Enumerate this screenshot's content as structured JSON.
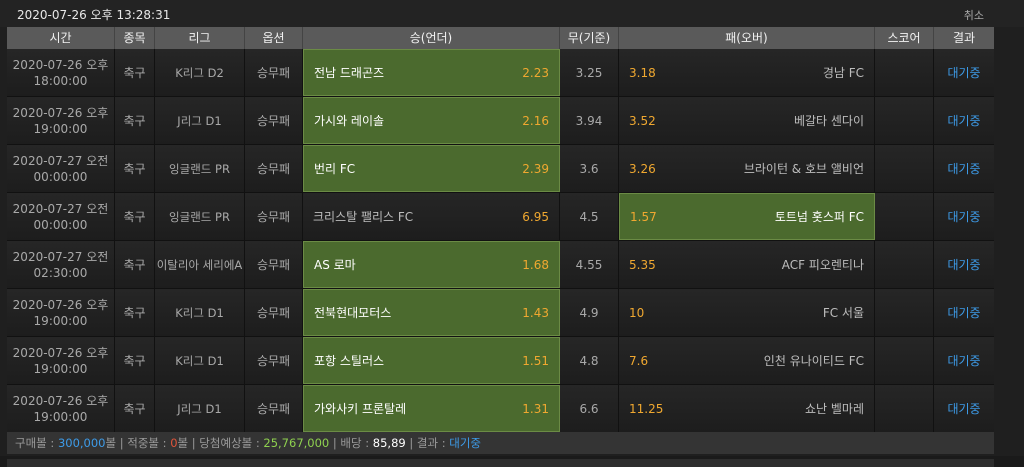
{
  "top": {
    "datetime": "2020-07-26 오후 13:28:31",
    "cancel_label": "취소"
  },
  "columns": [
    "시간",
    "종목",
    "리그",
    "옵션",
    "승(언더)",
    "무(기준)",
    "패(오버)",
    "스코어",
    "결과"
  ],
  "rows": [
    {
      "date": "2020-07-26 오후",
      "time": "18:00:00",
      "sport": "축구",
      "league": "K리그 D2",
      "option": "승무패",
      "home": "전남 드래곤즈",
      "home_odds": "2.23",
      "draw": "3.25",
      "away_odds": "3.18",
      "away": "경남 FC",
      "score": "",
      "result": "대기중",
      "selected": "home"
    },
    {
      "date": "2020-07-26 오후",
      "time": "19:00:00",
      "sport": "축구",
      "league": "J리그 D1",
      "option": "승무패",
      "home": "가시와 레이솔",
      "home_odds": "2.16",
      "draw": "3.94",
      "away_odds": "3.52",
      "away": "베갈타 센다이",
      "score": "",
      "result": "대기중",
      "selected": "home"
    },
    {
      "date": "2020-07-27 오전",
      "time": "00:00:00",
      "sport": "축구",
      "league": "잉글랜드 PR",
      "option": "승무패",
      "home": "번리 FC",
      "home_odds": "2.39",
      "draw": "3.6",
      "away_odds": "3.26",
      "away": "브라이턴 & 호브 앨비언",
      "score": "",
      "result": "대기중",
      "selected": "home"
    },
    {
      "date": "2020-07-27 오전",
      "time": "00:00:00",
      "sport": "축구",
      "league": "잉글랜드 PR",
      "option": "승무패",
      "home": "크리스탈 팰리스 FC",
      "home_odds": "6.95",
      "draw": "4.5",
      "away_odds": "1.57",
      "away": "토트넘 홋스퍼 FC",
      "score": "",
      "result": "대기중",
      "selected": "away"
    },
    {
      "date": "2020-07-27 오전",
      "time": "02:30:00",
      "sport": "축구",
      "league": "이탈리아 세리에A",
      "option": "승무패",
      "home": "AS 로마",
      "home_odds": "1.68",
      "draw": "4.55",
      "away_odds": "5.35",
      "away": "ACF 피오렌티나",
      "score": "",
      "result": "대기중",
      "selected": "home"
    },
    {
      "date": "2020-07-26 오후",
      "time": "19:00:00",
      "sport": "축구",
      "league": "K리그 D1",
      "option": "승무패",
      "home": "전북현대모터스",
      "home_odds": "1.43",
      "draw": "4.9",
      "away_odds": "10",
      "away": "FC 서울",
      "score": "",
      "result": "대기중",
      "selected": "home"
    },
    {
      "date": "2020-07-26 오후",
      "time": "19:00:00",
      "sport": "축구",
      "league": "K리그 D1",
      "option": "승무패",
      "home": "포항 스틸러스",
      "home_odds": "1.51",
      "draw": "4.8",
      "away_odds": "7.6",
      "away": "인천 유나이티드 FC",
      "score": "",
      "result": "대기중",
      "selected": "home"
    },
    {
      "date": "2020-07-26 오후",
      "time": "19:00:00",
      "sport": "축구",
      "league": "J리그 D1",
      "option": "승무패",
      "home": "가와사키 프론탈레",
      "home_odds": "1.31",
      "draw": "6.6",
      "away_odds": "11.25",
      "away": "쇼난 벨마레",
      "score": "",
      "result": "대기중",
      "selected": "home"
    }
  ],
  "footer": {
    "buy_label": "구매볼 : ",
    "buy_value": "300,000",
    "unit1": "볼 | 적중볼 : ",
    "hit_value": "0",
    "unit2": "볼 | 당첨예상볼 : ",
    "expected_value": "25,767,000",
    "odds_label": " | 배당 : ",
    "odds_value": "85,89",
    "result_label": " | 결과 : ",
    "result_value": "대기중"
  }
}
